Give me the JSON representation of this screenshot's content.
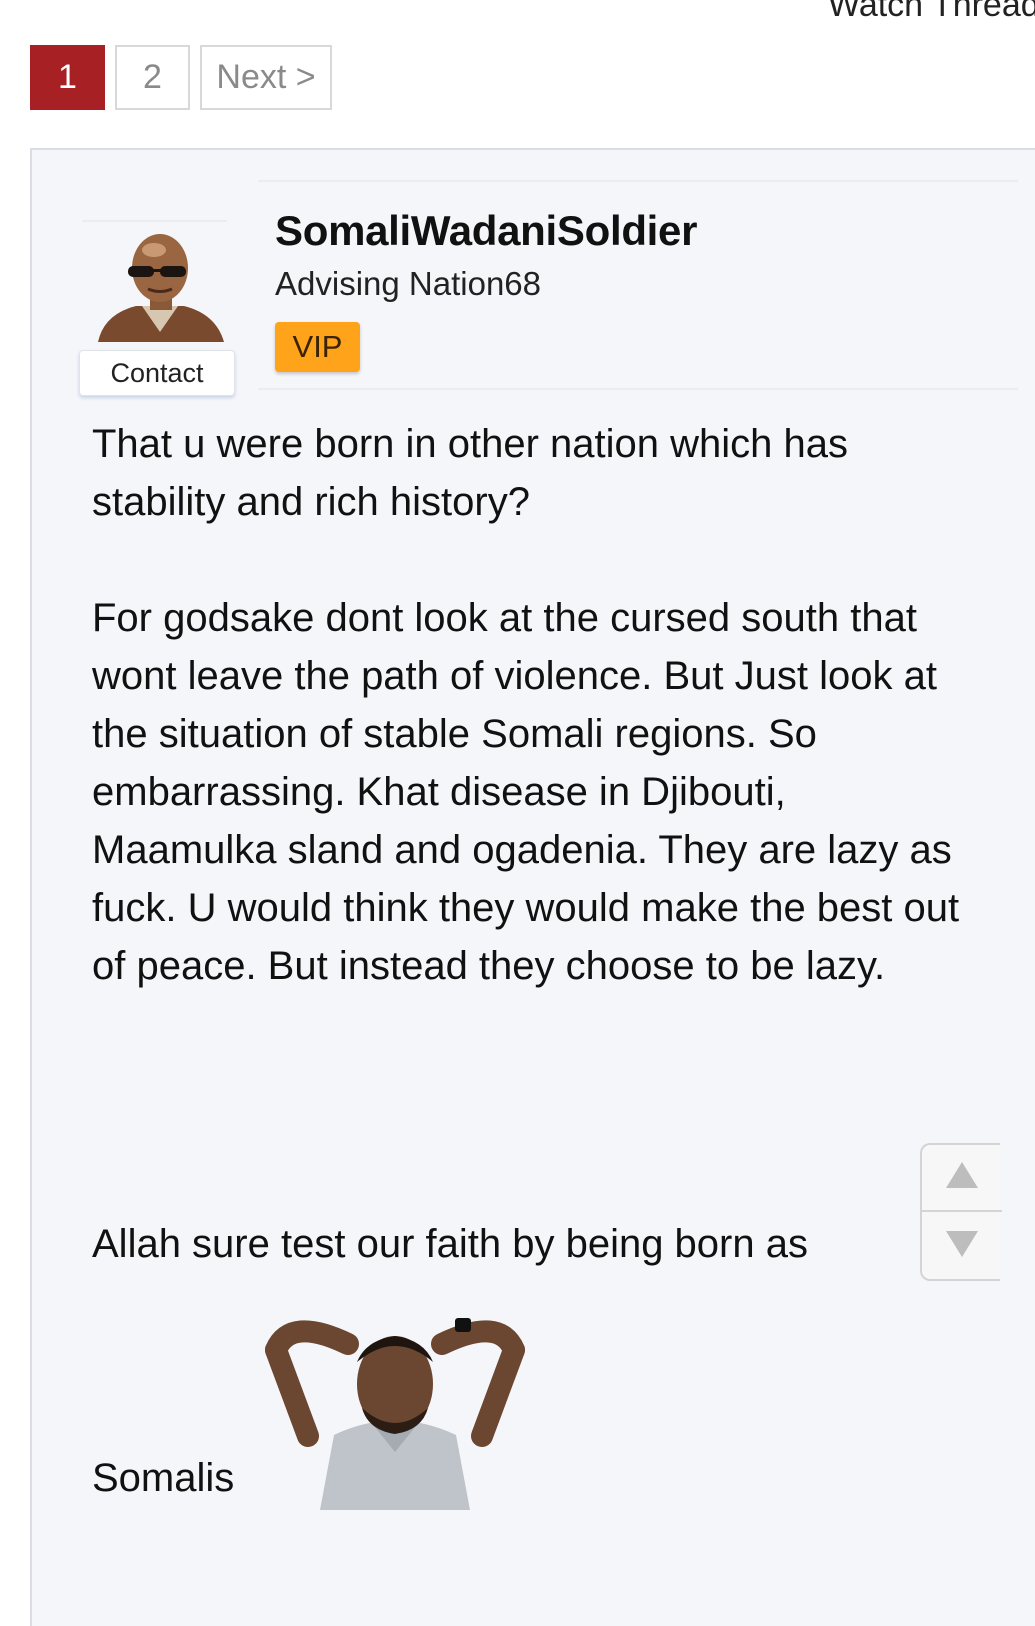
{
  "header": {
    "watch_thread": "Watch Thread"
  },
  "pagination": {
    "pages": [
      "1",
      "2"
    ],
    "active": "1",
    "next_label": "Next >"
  },
  "post": {
    "username": "SomaliWadaniSoldier",
    "user_title": "Advising Nation68",
    "badge": "VIP",
    "contact_label": "Contact",
    "paragraphs": [
      "That u were born in other nation which has stability and rich history?",
      "For godsake dont look at the cursed south that wont leave the path of violence. But Just look at the situation of stable Somali regions. So embarrassing. Khat disease in Djibouti, Maamulka sland and ogadenia. They are lazy as fuck. U would think they would make the best out of peace. But instead they choose to be lazy.",
      "Allah sure test our faith by being born as",
      "Somalis"
    ]
  },
  "icons": {
    "scroll_up": "triangle-up-icon",
    "scroll_down": "triangle-down-icon"
  },
  "colors": {
    "active_page": "#a72024",
    "vip_badge": "#ffa31a",
    "post_bg": "#f5f6fa"
  }
}
